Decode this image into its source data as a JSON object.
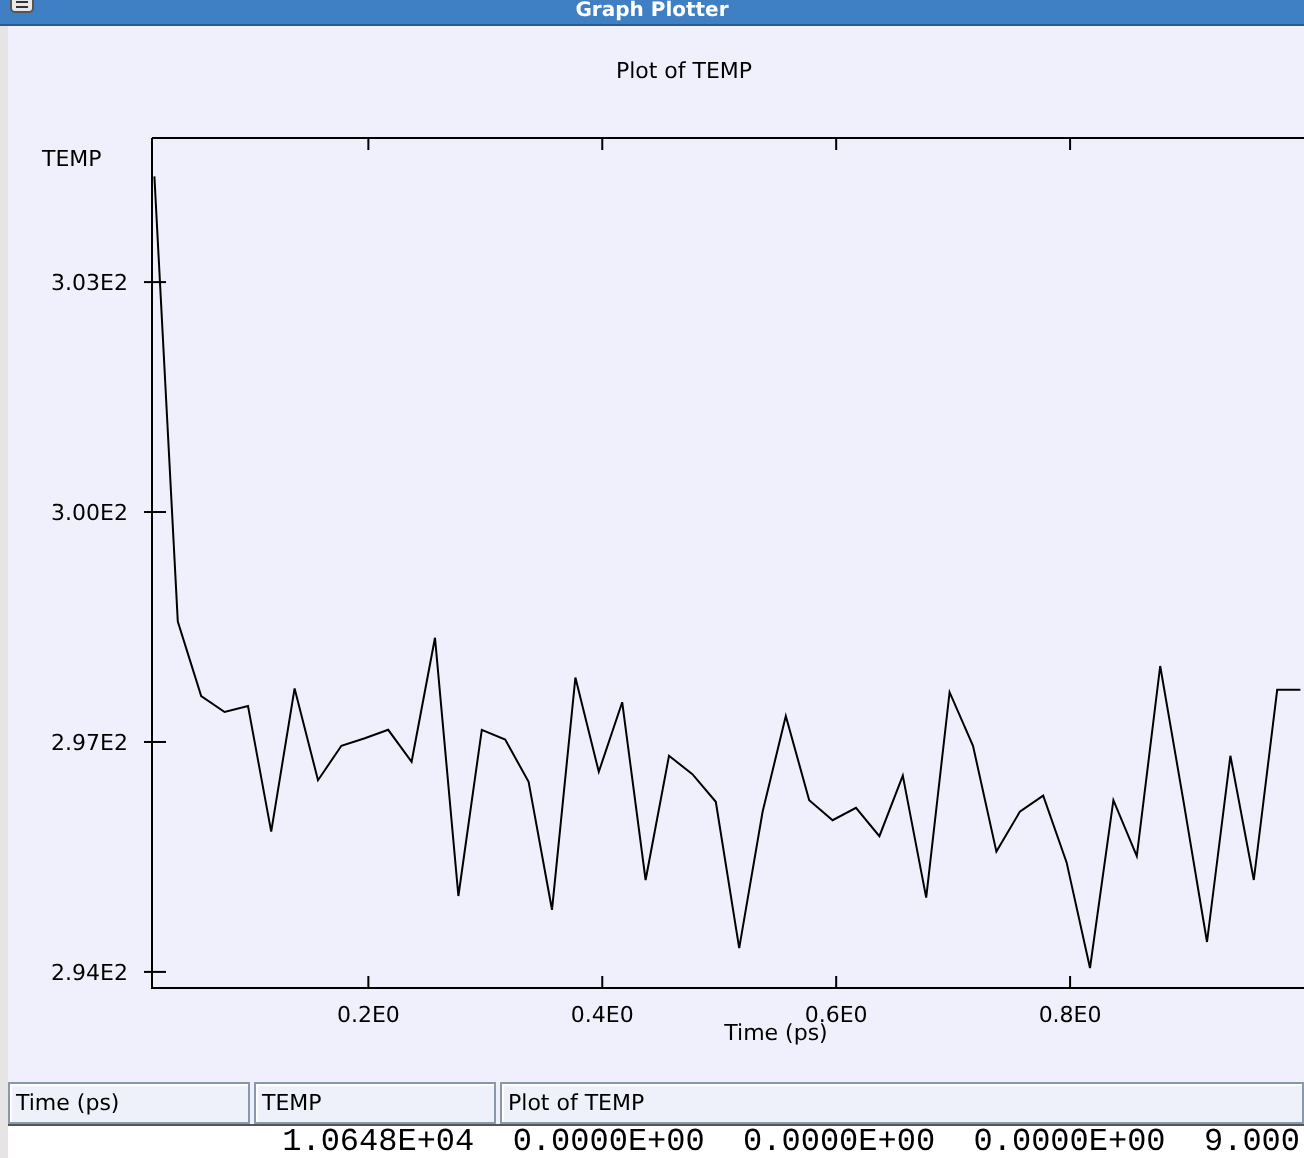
{
  "window": {
    "title": "Graph Plotter"
  },
  "plot": {
    "chart_data": {
      "type": "line",
      "title": "Plot of TEMP",
      "xlabel": "Time (ps)",
      "ylabel": "TEMP",
      "x": [
        0.017,
        0.037,
        0.057,
        0.077,
        0.097,
        0.117,
        0.137,
        0.157,
        0.177,
        0.197,
        0.217,
        0.237,
        0.257,
        0.277,
        0.297,
        0.317,
        0.337,
        0.357,
        0.377,
        0.397,
        0.417,
        0.437,
        0.457,
        0.477,
        0.497,
        0.517,
        0.537,
        0.557,
        0.577,
        0.597,
        0.617,
        0.637,
        0.657,
        0.677,
        0.697,
        0.717,
        0.737,
        0.757,
        0.777,
        0.797,
        0.817,
        0.837,
        0.857,
        0.877,
        0.897,
        0.917,
        0.937,
        0.957,
        0.977,
        0.997
      ],
      "series": [
        {
          "color": "#000000",
          "values": [
            304.38,
            298.57,
            297.6,
            297.39,
            297.47,
            295.83,
            297.7,
            296.5,
            296.95,
            297.05,
            297.16,
            296.74,
            298.36,
            294.99,
            297.16,
            297.03,
            296.48,
            294.81,
            297.84,
            296.61,
            297.52,
            295.2,
            296.82,
            296.58,
            296.22,
            294.31,
            296.09,
            297.34,
            296.24,
            295.98,
            296.14,
            295.77,
            296.56,
            294.97,
            297.65,
            296.95,
            295.57,
            296.09,
            296.3,
            295.43,
            294.05,
            296.24,
            295.51,
            297.99,
            296.22,
            294.39,
            296.82,
            295.2,
            297.68,
            297.68
          ]
        }
      ],
      "xlim": [
        0.015,
        1.0
      ],
      "ylim": [
        293.79,
        304.88
      ],
      "xticks": [
        {
          "value": 0.2,
          "label": "0.2E0"
        },
        {
          "value": 0.4,
          "label": "0.4E0"
        },
        {
          "value": 0.6,
          "label": "0.6E0"
        },
        {
          "value": 0.8,
          "label": "0.8E0"
        }
      ],
      "yticks": [
        {
          "value": 294,
          "label": "2.94E2"
        },
        {
          "value": 297,
          "label": "2.97E2"
        },
        {
          "value": 300,
          "label": "3.00E2"
        },
        {
          "value": 303,
          "label": "3.03E2"
        }
      ]
    }
  },
  "table": {
    "columns": [
      "Time (ps)",
      "TEMP",
      "Plot of TEMP"
    ],
    "data_line": "1.0648E+04  0.0000E+00  0.0000E+00  0.0000E+00  9.000"
  }
}
